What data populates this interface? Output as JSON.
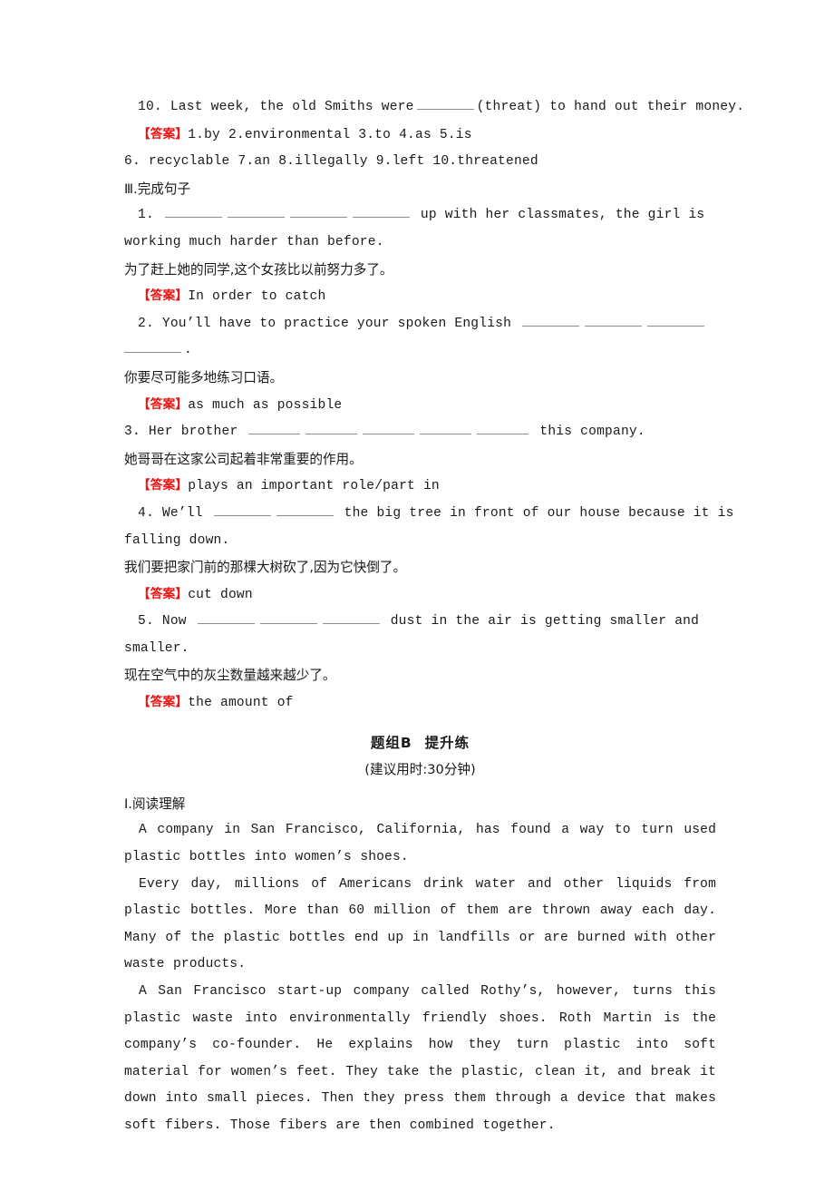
{
  "document": {
    "type": "english-workbook-answer-key",
    "answer_tag": "【答案】",
    "answer_tag_color": "#ee1111"
  },
  "section_fill_blank_tail": {
    "item10": {
      "number": "10.",
      "text_before": "Last week, the old Smiths were",
      "text_after": "(threat) to hand out their money.",
      "blanks": 1
    },
    "answers_line1": "1.by  2.environmental  3.to  4.as  5.is",
    "answers_line2": "6. recyclable  7.an  8.illegally  9.left  10.threatened"
  },
  "section_complete_sentences": {
    "heading": "Ⅲ.完成句子",
    "items": [
      {
        "number": "1.",
        "blanks": 4,
        "english_line1_after": "up with her classmates, the girl is",
        "english_line2": "working much harder than before.",
        "chinese": "为了赶上她的同学,这个女孩比以前努力多了。",
        "answer": "In order to catch"
      },
      {
        "number": "2.",
        "english_before": "You’ll have to practice your spoken English",
        "blanks_line1": 3,
        "blanks_line2": 1,
        "trailing": ".",
        "chinese": "你要尽可能多地练习口语。",
        "answer": "as much as possible"
      },
      {
        "number": "3.",
        "english_before": "Her brother",
        "blanks": 5,
        "english_after": "this company.",
        "chinese": "她哥哥在这家公司起着非常重要的作用。",
        "answer": "plays an important role/part in"
      },
      {
        "number": "4.",
        "english_before": "We’ll",
        "blanks": 2,
        "english_line1_after": "the big tree in front of our house because it is",
        "english_line2": "falling down.",
        "chinese": "我们要把家门前的那棵大树砍了,因为它快倒了。",
        "answer": "cut down"
      },
      {
        "number": "5.",
        "english_before": "Now",
        "blanks": 3,
        "english_line1_after": "dust in the air is getting smaller and",
        "english_line2": "smaller.",
        "chinese": "现在空气中的灰尘数量越来越少了。",
        "answer": "the amount of"
      }
    ]
  },
  "group_heading": {
    "title_prefix": "题组",
    "title_letter": "B",
    "title_suffix": "提升练",
    "subtitle": "(建议用时:30分钟)"
  },
  "section_reading": {
    "heading": "Ⅰ.阅读理解",
    "paragraphs": [
      "A company in San Francisco, California, has found a way to turn used plastic bottles into women’s shoes.",
      "Every day, millions of Americans drink water and other liquids from plastic bottles. More than 60 million of them are thrown away each day. Many of the plastic bottles end up in landfills or are burned with other waste products.",
      "A San Francisco start-up company called Rothy’s, however, turns this plastic waste into environmentally friendly shoes. Roth Martin is the company’s co-founder. He explains how they turn plastic into soft material for women’s feet. They take the plastic, clean it, and break it down into small pieces. Then they press them through a device that makes soft fibers. Those fibers are then combined together."
    ]
  }
}
